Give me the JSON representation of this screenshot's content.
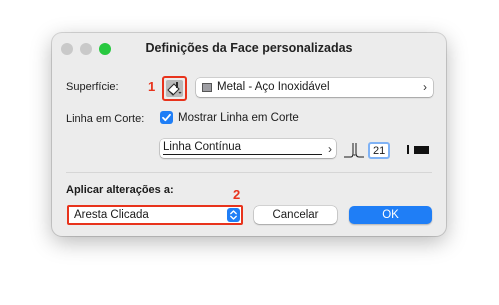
{
  "window": {
    "title": "Definições da Face personalizadas",
    "traffic_light_colors": [
      "#c9c9c9",
      "#c9c9c9",
      "#28c840"
    ]
  },
  "surface": {
    "label": "Superfície:",
    "marker": "1",
    "material_name": "Metal - Aço Inoxidável",
    "material_icon": "material-swatch-icon"
  },
  "cut_line": {
    "label": "Linha em Corte:",
    "show_checkbox_label": "Mostrar Linha em Corte",
    "show_checked": true,
    "line_type": "Linha Contínua",
    "pen_number": "21"
  },
  "apply": {
    "label": "Aplicar alterações a:",
    "marker": "2",
    "selected_option": "Aresta Clicada"
  },
  "buttons": {
    "cancel": "Cancelar",
    "ok": "OK"
  },
  "colors": {
    "accent": "#1f7ef6",
    "highlight": "#e8331c"
  }
}
